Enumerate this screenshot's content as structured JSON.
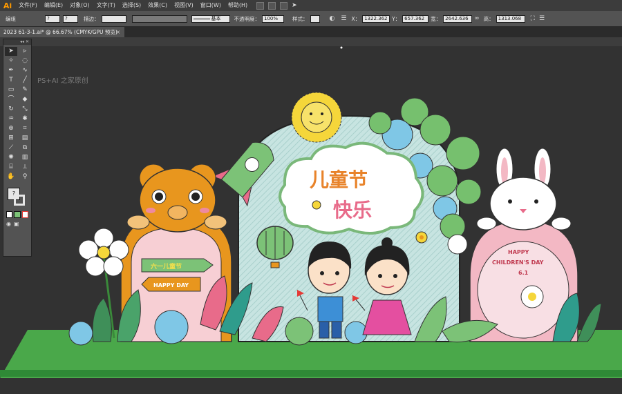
{
  "app": {
    "logo": "Ai"
  },
  "menu": [
    "文件(F)",
    "编辑(E)",
    "对象(O)",
    "文字(T)",
    "选择(S)",
    "效果(C)",
    "视图(V)",
    "窗口(W)",
    "帮助(H)"
  ],
  "controls": {
    "mode_label": "编组",
    "stroke_label": "描边：",
    "stroke_style": "基本",
    "opacity_label": "不透明度：",
    "opacity_value": "100%",
    "style_label": "样式：",
    "x_label": "X：",
    "x_value": "1322.362",
    "y_label": "Y：",
    "y_value": "657.362",
    "w_label": "宽：",
    "w_value": "2642.636",
    "h_label": "高：",
    "h_value": "1313.068"
  },
  "document": {
    "tab_title": "2023 61-3-1.ai* @ 66.67% (CMYK/GPU 预览)",
    "close": "×"
  },
  "watermark": "PS+AI 之家原创",
  "artwork": {
    "title_line1": "儿童节",
    "title_line2": "快乐",
    "sign_left_top": "六一儿童节",
    "sign_left_bottom": "HAPPY DAY",
    "rabbit_text_1": "HAPPY",
    "rabbit_text_2": "CHILDREN'S DAY",
    "rabbit_text_3": "6.1"
  },
  "colors": {
    "ground": "#4caf50",
    "bear": "#e8961e",
    "panel": "#c6e2df",
    "rabbit_body": "#f3b8c4",
    "sun": "#f5d63a"
  }
}
